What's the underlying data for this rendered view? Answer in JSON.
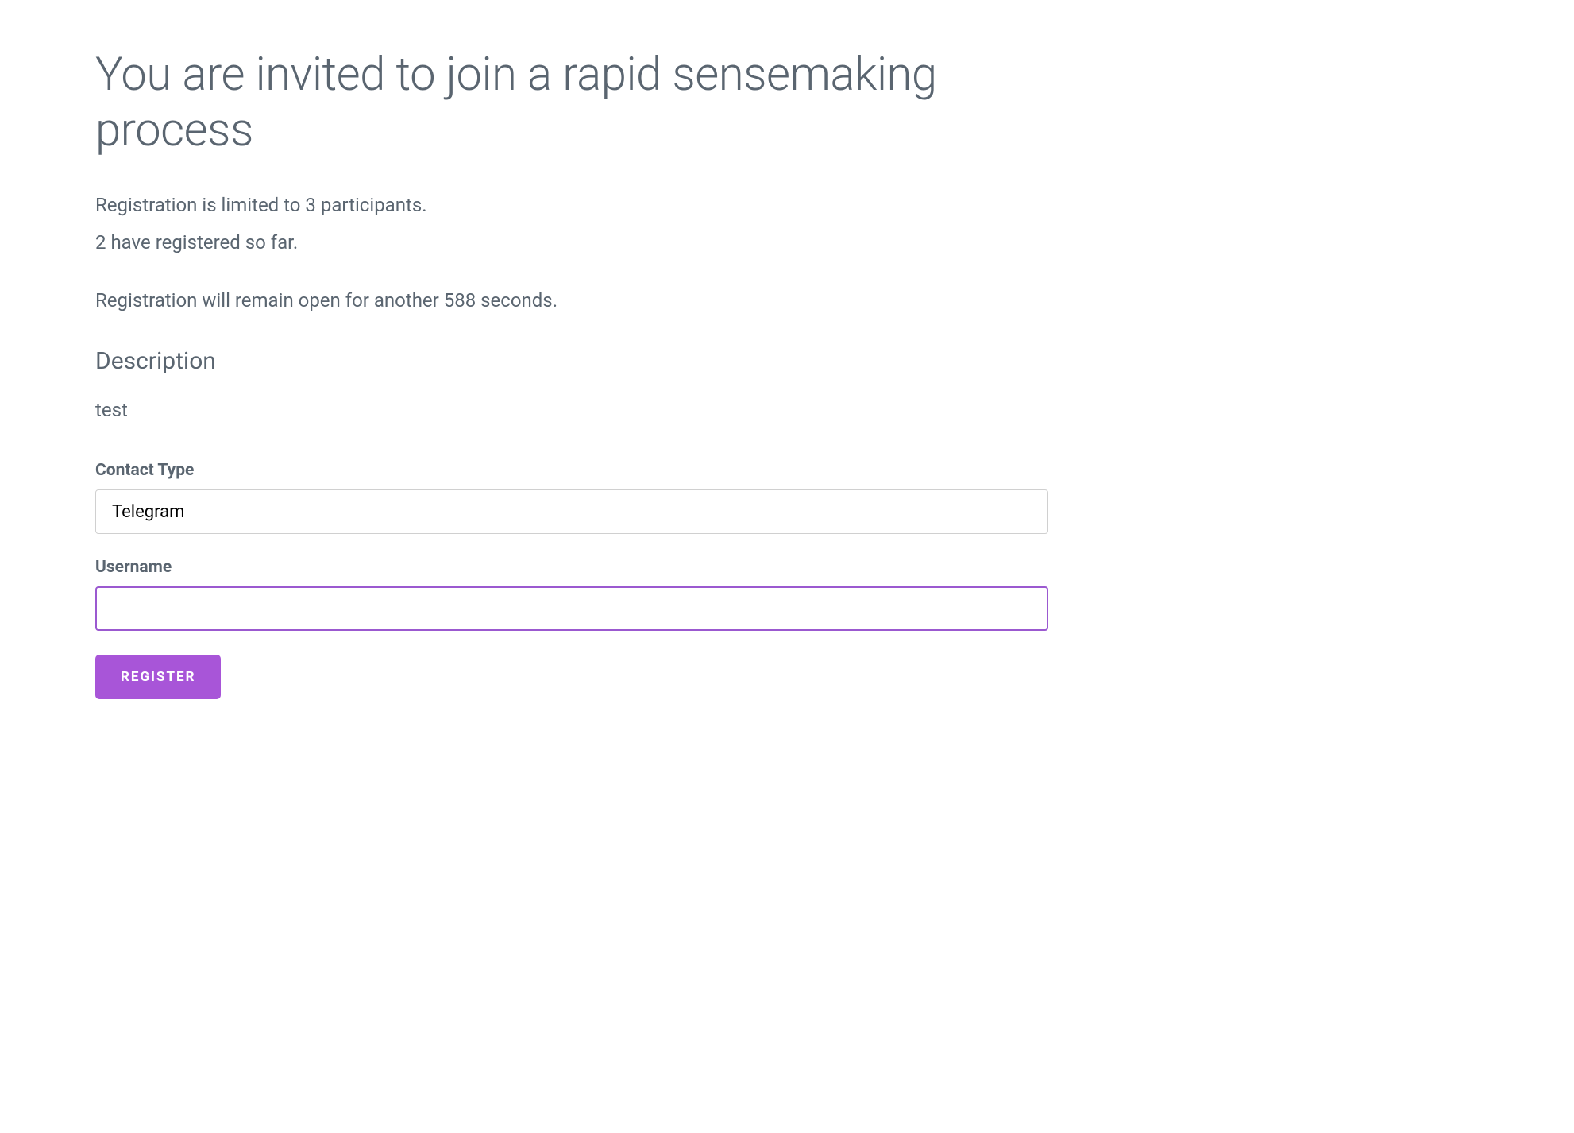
{
  "page": {
    "title": "You are invited to join a rapid sensemaking process",
    "registration_limit_text": "Registration is limited to 3 participants.",
    "registered_count_text": "2 have registered so far.",
    "timer_text": "Registration will remain open for another 588 seconds.",
    "description_heading": "Description",
    "description_body": "test"
  },
  "form": {
    "contact_type_label": "Contact Type",
    "contact_type_value": "Telegram",
    "username_label": "Username",
    "username_value": "",
    "register_button_label": "REGISTER"
  },
  "colors": {
    "accent": "#a855d8",
    "text_muted": "#5a6570",
    "input_focus_border": "#9b59d0"
  }
}
